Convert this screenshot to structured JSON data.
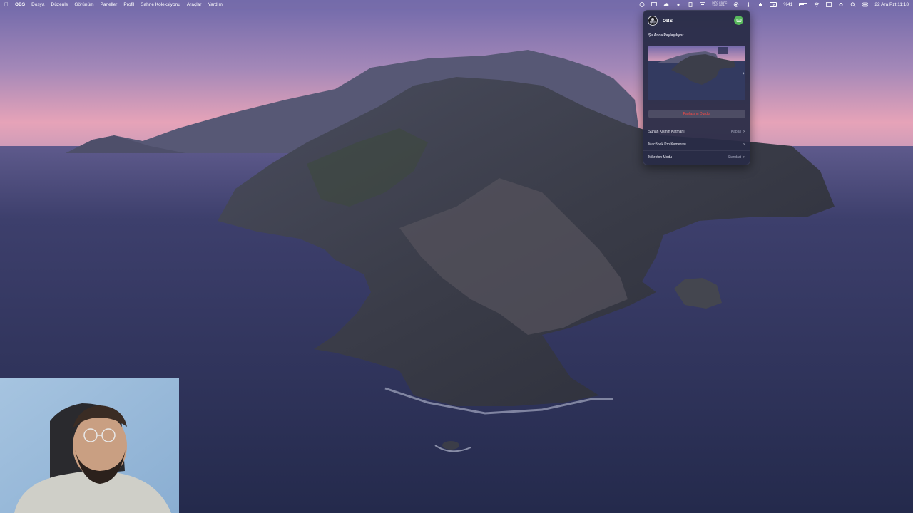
{
  "menubar": {
    "apple_icon": "apple-icon",
    "app_name": "OBS",
    "items": [
      "Dosya",
      "Düzenle",
      "Görünüm",
      "Paneller",
      "Profil",
      "Sahne Koleksiyonu",
      "Araçlar",
      "Yardım"
    ],
    "status": {
      "sensor_line1": "56°C | 53°C",
      "sensor_line2": "2403 RPM",
      "input_badge": "TR",
      "battery": "%41",
      "datetime": "22 Ara Pzt  11:18"
    },
    "status_icons": [
      "screen-sharing-icon",
      "cloud-icon",
      "brightness-icon",
      "script-icon",
      "monitor-icon",
      "thermometer-icon",
      "record-icon",
      "hand-icon",
      "bracket-icon",
      "wifi-icon",
      "display-icon",
      "settings-icon",
      "search-icon",
      "control-center-icon",
      "battery-icon"
    ]
  },
  "popover": {
    "title": "OBS",
    "section_label": "Şu Anda Paylaşılıyor",
    "stop_button": "Paylaşımı Durdur",
    "rows": [
      {
        "label": "Sunan Kişinin Katmanı",
        "value": "Kapalı"
      },
      {
        "label": "MacBook Pro Kamerası",
        "value": ""
      },
      {
        "label": "Mikrofon Modu",
        "value": "Standart"
      }
    ]
  },
  "colors": {
    "sky_top": "#7e6fb2",
    "sky_glow": "#e8a0b8",
    "sea": "#2b3157",
    "share_button": "#58b85c",
    "stop_text": "#ff4a44"
  }
}
